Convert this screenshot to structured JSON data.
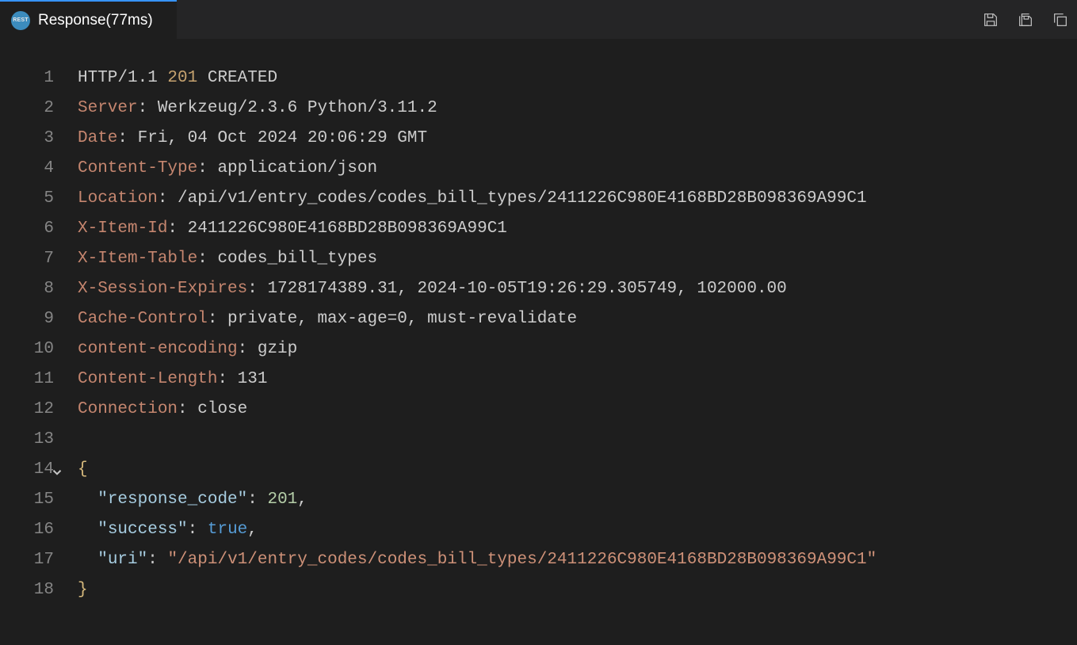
{
  "tab": {
    "icon_label": "REST",
    "title": "Response(77ms)"
  },
  "gutter": [
    "1",
    "2",
    "3",
    "4",
    "5",
    "6",
    "7",
    "8",
    "9",
    "10",
    "11",
    "12",
    "13",
    "14",
    "15",
    "16",
    "17",
    "18"
  ],
  "status_line": {
    "protocol": "HTTP/1.1",
    "code": "201",
    "text": "CREATED"
  },
  "headers": [
    {
      "k": "Server",
      "v": "Werkzeug/2.3.6 Python/3.11.2"
    },
    {
      "k": "Date",
      "v": "Fri, 04 Oct 2024 20:06:29 GMT"
    },
    {
      "k": "Content-Type",
      "v": "application/json"
    },
    {
      "k": "Location",
      "v": "/api/v1/entry_codes/codes_bill_types/2411226C980E4168BD28B098369A99C1"
    },
    {
      "k": "X-Item-Id",
      "v": "2411226C980E4168BD28B098369A99C1"
    },
    {
      "k": "X-Item-Table",
      "v": "codes_bill_types"
    },
    {
      "k": "X-Session-Expires",
      "v": "1728174389.31, 2024-10-05T19:26:29.305749, 102000.00"
    },
    {
      "k": "Cache-Control",
      "v": "private, max-age=0, must-revalidate"
    },
    {
      "k": "content-encoding",
      "v": "gzip"
    },
    {
      "k": "Content-Length",
      "v": "131"
    },
    {
      "k": "Connection",
      "v": "close"
    }
  ],
  "json_body": {
    "open_brace": "{",
    "close_brace": "}",
    "entries": [
      {
        "key": "\"response_code\"",
        "kind": "num",
        "value": "201",
        "comma": ","
      },
      {
        "key": "\"success\"",
        "kind": "bool",
        "value": "true",
        "comma": ","
      },
      {
        "key": "\"uri\"",
        "kind": "str",
        "value": "\"/api/v1/entry_codes/codes_bill_types/2411226C980E4168BD28B098369A99C1\"",
        "comma": ""
      }
    ]
  }
}
